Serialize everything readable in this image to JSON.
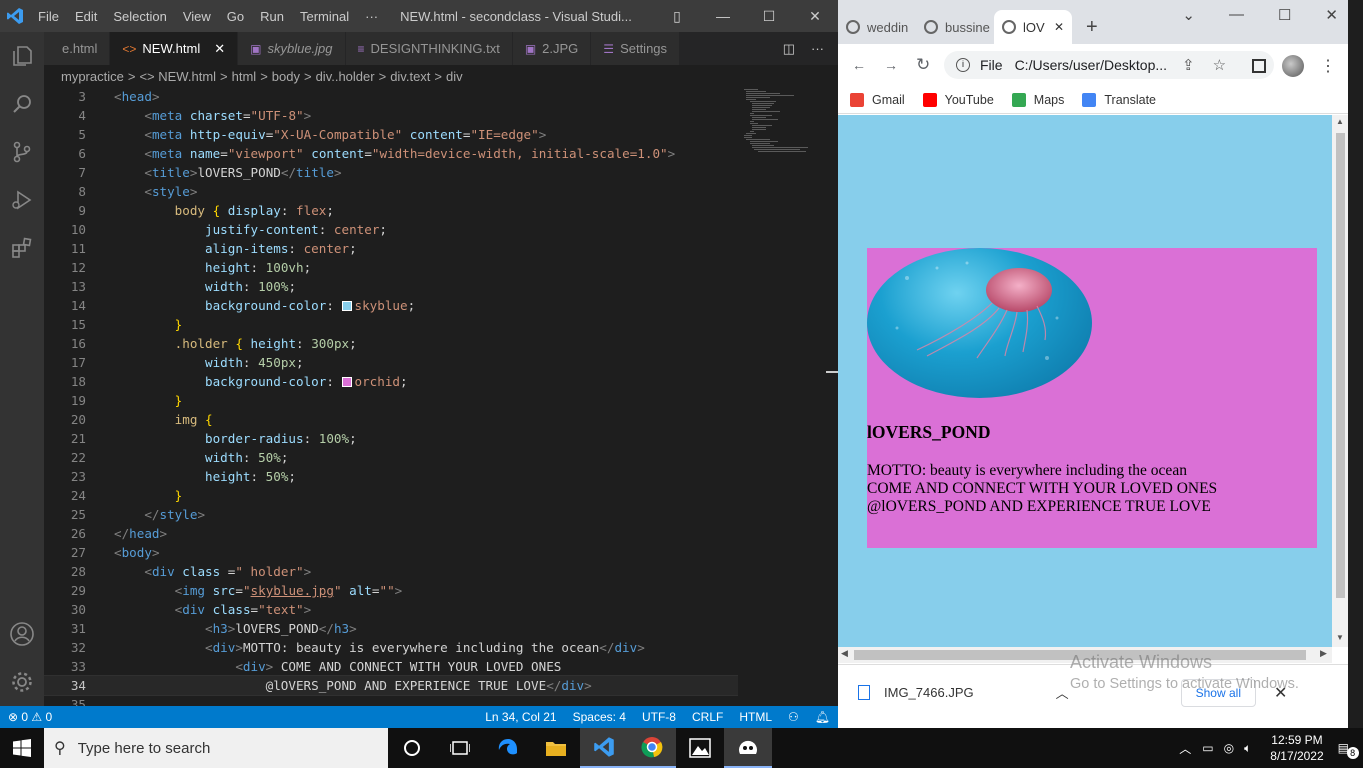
{
  "vscode": {
    "menu": [
      "File",
      "Edit",
      "Selection",
      "View",
      "Go",
      "Run",
      "Terminal",
      "···"
    ],
    "window_title": "NEW.html - secondclass - Visual Studi...",
    "tabs": [
      {
        "label": "e.html",
        "icon": ""
      },
      {
        "label": "NEW.html",
        "icon": "<>"
      },
      {
        "label": "skyblue.jpg",
        "icon": "▣"
      },
      {
        "label": "DESIGNTHINKING.txt",
        "icon": "≡"
      },
      {
        "label": "2.JPG",
        "icon": "▣"
      },
      {
        "label": "Settings",
        "icon": "☰"
      }
    ],
    "breadcrumb": [
      "mypractice",
      ">",
      "<> NEW.html",
      ">",
      "html",
      ">",
      "body",
      ">",
      "div..holder",
      ">",
      "div.text",
      ">",
      "div"
    ],
    "status": {
      "errors": "⊗ 0 ⚠ 0",
      "position": "Ln 34, Col 21",
      "spaces": "Spaces: 4",
      "encoding": "UTF-8",
      "eol": "CRLF",
      "language": "HTML"
    },
    "code_lines": [
      {
        "n": "3",
        "html": "<span class='t'>&lt;</span><span class='tn'>head</span><span class='t'>&gt;</span>"
      },
      {
        "n": "4",
        "html": "    <span class='t'>&lt;</span><span class='tn'>meta</span> <span class='at'>charset</span>=<span class='sv'>\"UTF-8\"</span><span class='t'>&gt;</span>"
      },
      {
        "n": "5",
        "html": "    <span class='t'>&lt;</span><span class='tn'>meta</span> <span class='at'>http-equiv</span>=<span class='sv'>\"X-UA-Compatible\"</span> <span class='at'>content</span>=<span class='sv'>\"IE=edge\"</span><span class='t'>&gt;</span>"
      },
      {
        "n": "6",
        "html": "    <span class='t'>&lt;</span><span class='tn'>meta</span> <span class='at'>name</span>=<span class='sv'>\"viewport\"</span> <span class='at'>content</span>=<span class='sv'>\"width=device-width, initial-scale=1.0\"</span><span class='t'>&gt;</span>"
      },
      {
        "n": "7",
        "html": "    <span class='t'>&lt;</span><span class='tn'>title</span><span class='t'>&gt;</span>lOVERS_POND<span class='t'>&lt;/</span><span class='tn'>title</span><span class='t'>&gt;</span>"
      },
      {
        "n": "8",
        "html": "    <span class='t'>&lt;</span><span class='tn'>style</span><span class='t'>&gt;</span>"
      },
      {
        "n": "9",
        "html": "        <span class='sel'>body</span> <span class='br'>{</span> <span class='pr'>display</span>: <span class='vl'>flex</span>;"
      },
      {
        "n": "10",
        "html": "            <span class='pr'>justify-content</span>: <span class='vl'>center</span>;"
      },
      {
        "n": "11",
        "html": "            <span class='pr'>align-items</span>: <span class='vl'>center</span>;"
      },
      {
        "n": "12",
        "html": "            <span class='pr'>height</span>: <span class='nm'>100vh</span>;"
      },
      {
        "n": "13",
        "html": "            <span class='pr'>width</span>: <span class='nm'>100%</span>;"
      },
      {
        "n": "14",
        "html": "            <span class='pr'>background-color</span>: <span class='sw' style='background:#87ceeb'></span><span class='vl'>skyblue</span>;"
      },
      {
        "n": "15",
        "html": "        <span class='br'>}</span>"
      },
      {
        "n": "16",
        "html": "        <span class='sel'>.holder</span> <span class='br'>{</span> <span class='pr'>height</span>: <span class='nm'>300px</span>;"
      },
      {
        "n": "17",
        "html": "            <span class='pr'>width</span>: <span class='nm'>450px</span>;"
      },
      {
        "n": "18",
        "html": "            <span class='pr'>background-color</span>: <span class='sw' style='background:#da70d6'></span><span class='vl'>orchid</span>;"
      },
      {
        "n": "19",
        "html": "        <span class='br'>}</span>"
      },
      {
        "n": "20",
        "html": "        <span class='sel'>img</span> <span class='br'>{</span>"
      },
      {
        "n": "21",
        "html": "            <span class='pr'>border-radius</span>: <span class='nm'>100%</span>;"
      },
      {
        "n": "22",
        "html": "            <span class='pr'>width</span>: <span class='nm'>50%</span>;"
      },
      {
        "n": "23",
        "html": "            <span class='pr'>height</span>: <span class='nm'>50%</span>;"
      },
      {
        "n": "24",
        "html": "        <span class='br'>}</span>"
      },
      {
        "n": "25",
        "html": "    <span class='t'>&lt;/</span><span class='tn'>style</span><span class='t'>&gt;</span>"
      },
      {
        "n": "26",
        "html": "<span class='t'>&lt;/</span><span class='tn'>head</span><span class='t'>&gt;</span>"
      },
      {
        "n": "27",
        "html": "<span class='t'>&lt;</span><span class='tn'>body</span><span class='t'>&gt;</span>"
      },
      {
        "n": "28",
        "html": "    <span class='t'>&lt;</span><span class='tn'>div</span> <span class='at'>class</span> =<span class='sv'>\" holder\"</span><span class='t'>&gt;</span>"
      },
      {
        "n": "29",
        "html": "        <span class='t'>&lt;</span><span class='tn'>img</span> <span class='at'>src</span>=<span class='sv'>\"<u>skyblue.jpg</u>\"</span> <span class='at'>alt</span>=<span class='sv'>\"\"</span><span class='t'>&gt;</span>"
      },
      {
        "n": "30",
        "html": "        <span class='t'>&lt;</span><span class='tn'>div</span> <span class='at'>class</span>=<span class='sv'>\"text\"</span><span class='t'>&gt;</span>"
      },
      {
        "n": "31",
        "html": "            <span class='t'>&lt;</span><span class='tn'>h3</span><span class='t'>&gt;</span>lOVERS_POND<span class='t'>&lt;/</span><span class='tn'>h3</span><span class='t'>&gt;</span>"
      },
      {
        "n": "32",
        "html": "            <span class='t'>&lt;</span><span class='tn'>div</span><span class='t'>&gt;</span>MOTTO: beauty is everywhere including the ocean<span class='t'>&lt;/</span><span class='tn'>div</span><span class='t'>&gt;</span>"
      },
      {
        "n": "33",
        "html": "                <span class='t'>&lt;</span><span class='tn'>div</span><span class='t'>&gt;</span> COME AND CONNECT WITH YOUR LOVED ONES"
      },
      {
        "n": "34",
        "html": "                    @lOVERS_POND AND EXPERIENCE TRUE LOVE<span class='t'>&lt;/</span><span class='tn'>div</span><span class='t'>&gt;</span>"
      },
      {
        "n": "35",
        "html": ""
      }
    ]
  },
  "chrome": {
    "tabs": [
      "weddin",
      "bussine",
      "lOV"
    ],
    "url": "C:/Users/user/Desktop...",
    "file_label": "File",
    "bookmarks": [
      {
        "label": "Gmail",
        "color": "#ea4335"
      },
      {
        "label": "YouTube",
        "color": "#ff0000"
      },
      {
        "label": "Maps",
        "color": "#34a853"
      },
      {
        "label": "Translate",
        "color": "#4285f4"
      }
    ],
    "page": {
      "heading": "lOVERS_POND",
      "lines": [
        "MOTTO: beauty is everywhere including the ocean",
        "COME AND CONNECT WITH YOUR LOVED ONES",
        "@lOVERS_POND AND EXPERIENCE TRUE LOVE"
      ]
    },
    "download": {
      "file": "IMG_7466.JPG",
      "show_all": "Show all"
    },
    "watermark": {
      "title": "Activate Windows",
      "subtitle": "Go to Settings to activate Windows."
    }
  },
  "taskbar": {
    "search_placeholder": "Type here to search",
    "time": "12:59 PM",
    "date": "8/17/2022",
    "notifications": "8"
  }
}
